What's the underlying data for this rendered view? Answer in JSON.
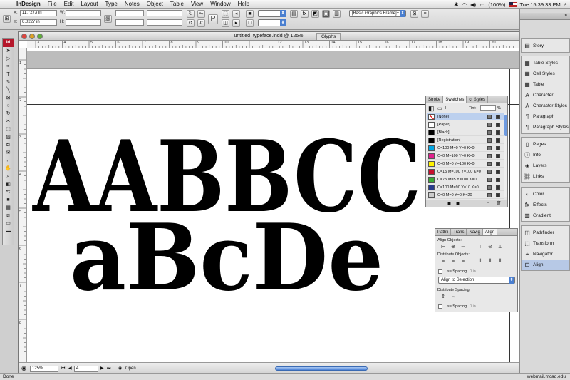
{
  "menubar": {
    "app": "InDesign",
    "items": [
      "File",
      "Edit",
      "Layout",
      "Type",
      "Notes",
      "Object",
      "Table",
      "View",
      "Window",
      "Help"
    ],
    "battery": "(100%)",
    "clock": "Tue 15:39:33 PM"
  },
  "control": {
    "x_label": "X:",
    "x_value": "11.7273 in",
    "y_label": "Y:",
    "y_value": "6.0227 in",
    "w_label": "W:",
    "h_label": "H:",
    "stroke_value": "",
    "frame_style": "[Basic Graphics Frame]+"
  },
  "document": {
    "title": "untitled_typeface.indd @ 125%",
    "glyphs_tab": "Glyphs",
    "ruler_h": [
      "3",
      "4",
      "5",
      "6",
      "7",
      "8",
      "9",
      "10",
      "11",
      "12",
      "13",
      "14",
      "15",
      "16",
      "17",
      "18",
      "19",
      "20"
    ],
    "ruler_v": [
      "1",
      "2",
      "3",
      "4",
      "5",
      "6",
      "7",
      "8"
    ],
    "art_line1": "AABBCC",
    "art_line2": "aBcDe"
  },
  "statusbar": {
    "zoom": "125%",
    "page": "4",
    "status": "Open"
  },
  "swatches": {
    "tabs": [
      "Stroke",
      "Swatches",
      "ct Styles"
    ],
    "tint_label": "Tint:",
    "tint_unit": "%",
    "rows": [
      {
        "name": "[None]",
        "color": "#ffffff"
      },
      {
        "name": "[Paper]",
        "color": "#ffffff"
      },
      {
        "name": "[Black]",
        "color": "#000000"
      },
      {
        "name": "[Registration]",
        "color": "#000000"
      },
      {
        "name": "C=100 M=0 Y=0 K=0",
        "color": "#00a6e4"
      },
      {
        "name": "C=0 M=100 Y=0 K=0",
        "color": "#e0208c"
      },
      {
        "name": "C=0 M=0 Y=100 K=0",
        "color": "#fff200"
      },
      {
        "name": "C=15 M=100 Y=100 K=0",
        "color": "#c8102e"
      },
      {
        "name": "C=75 M=5 Y=100 K=0",
        "color": "#3aa935"
      },
      {
        "name": "C=100 M=90 Y=10 K=0",
        "color": "#283c8c"
      },
      {
        "name": "C=0 M=0 Y=0 K=20",
        "color": "#cccccc"
      }
    ]
  },
  "align": {
    "tabs": [
      "Pathfi",
      "Trans",
      "Navig",
      "Align"
    ],
    "align_objects": "Align Objects:",
    "distribute_objects": "Distribute Objects:",
    "use_spacing": "Use Spacing",
    "spacing_value": "0 in",
    "align_to": "Align to Selection",
    "distribute_spacing": "Distribute Spacing:",
    "use_spacing2": "Use Spacing",
    "spacing_value2": "0 in"
  },
  "dock": {
    "group1": [
      "Story"
    ],
    "group2": [
      "Table Styles",
      "Cell Styles",
      "Table",
      "Character",
      "Character Styles",
      "Paragraph",
      "Paragraph Styles"
    ],
    "group3": [
      "Pages",
      "Info",
      "Layers",
      "Links"
    ],
    "group4": [
      "Color",
      "Effects",
      "Gradient"
    ],
    "group5": [
      "Pathfinder",
      "Transform",
      "Navigator",
      "Align"
    ]
  },
  "bottombar": {
    "left": "Done",
    "right": "webmail.mcad.edu"
  },
  "colors": {
    "accent": "#4a7fd0",
    "id_logo": "#b5172b"
  }
}
